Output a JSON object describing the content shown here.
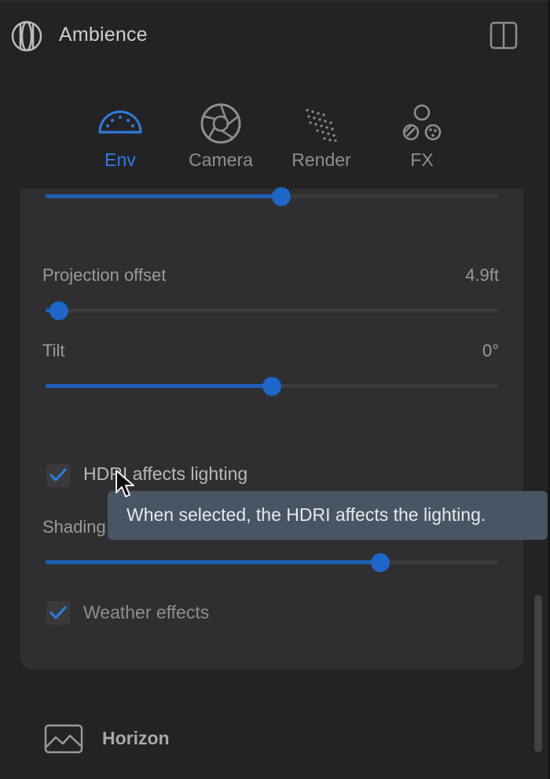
{
  "app": {
    "title": "Ambience"
  },
  "tabs": [
    {
      "label": "Env",
      "icon": "dome-icon",
      "active": true
    },
    {
      "label": "Camera",
      "icon": "aperture-icon",
      "active": false
    },
    {
      "label": "Render",
      "icon": "dot-grid-icon",
      "active": false
    },
    {
      "label": "FX",
      "icon": "shapes-icon",
      "active": false
    }
  ],
  "settings": {
    "top_slider": {
      "level": 0.52
    },
    "projection_offset": {
      "label": "Projection offset",
      "value": "4.9ft",
      "level": 0.03
    },
    "tilt": {
      "label": "Tilt",
      "value": "0°",
      "level": 0.5
    },
    "hdri_lighting": {
      "label": "HDRI affects lighting",
      "checked": true
    },
    "shading": {
      "label": "Shading",
      "level": 0.74
    },
    "weather": {
      "label": "Weather effects",
      "checked": true
    }
  },
  "tooltip": {
    "text": "When selected, the HDRI affects the lighting."
  },
  "sections": {
    "horizon": {
      "label": "Horizon",
      "icon": "landscape-image-icon"
    }
  },
  "colors": {
    "accent": "#2f7ce0",
    "background": "#232325",
    "panel": "#2f2f31",
    "tooltip": "#485565"
  }
}
